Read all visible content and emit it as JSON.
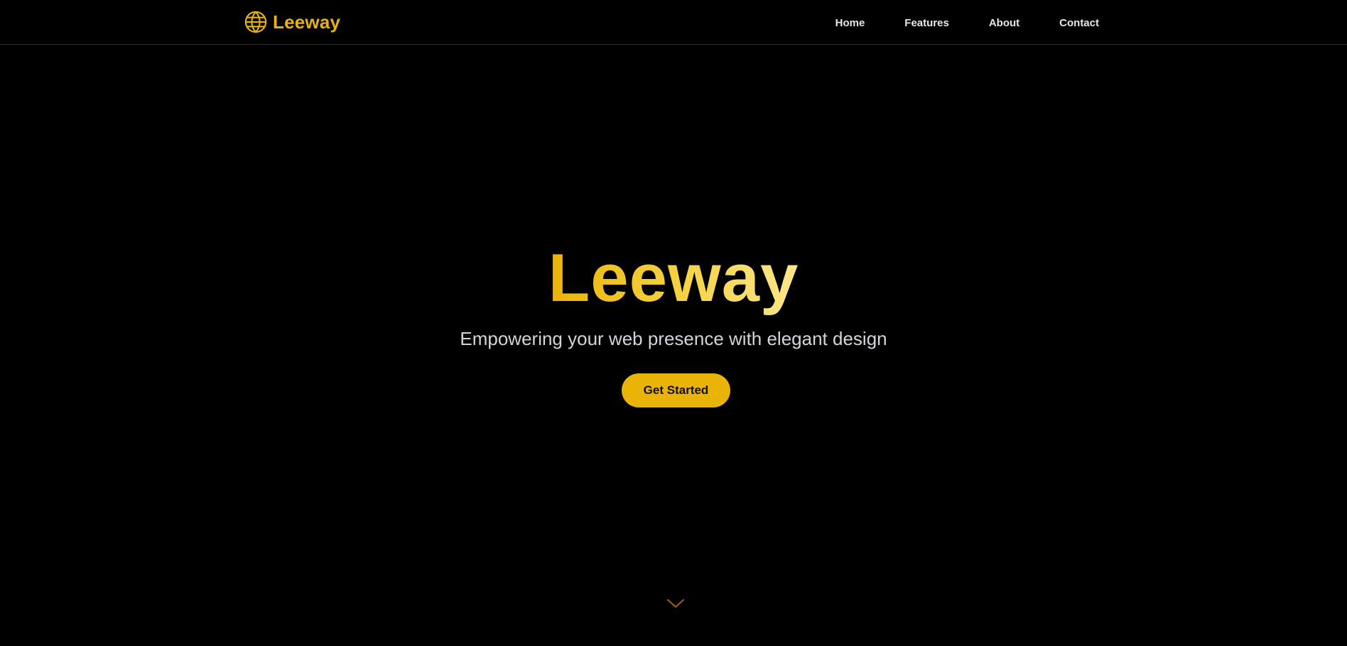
{
  "header": {
    "brand": {
      "name": "Leeway",
      "icon": "globe-icon"
    },
    "nav": [
      {
        "label": "Home"
      },
      {
        "label": "Features"
      },
      {
        "label": "About"
      },
      {
        "label": "Contact"
      }
    ]
  },
  "hero": {
    "title": "Leeway",
    "subtitle": "Empowering your web presence with elegant design",
    "cta_label": "Get Started",
    "scroll_icon": "chevron-down-icon"
  },
  "colors": {
    "background": "#000000",
    "accent": "#eab308",
    "accent_light": "#fde68a",
    "nav_text": "#e5e7eb",
    "subtitle_text": "#d1d5db",
    "scroll_icon": "#a16207"
  }
}
